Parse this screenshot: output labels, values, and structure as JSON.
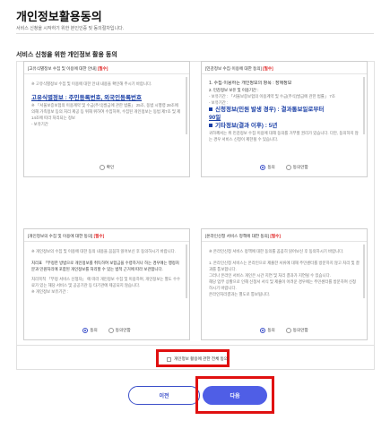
{
  "header": {
    "title": "개인정보활용동의",
    "subtitle": "서비스 신청을 시작하기 위한 본인인증 및 동의절차입니다."
  },
  "section_title": "서비스 신청을 위한 개인정보 활용 동의",
  "required_mark": "[필수]",
  "cards": [
    {
      "title": "[고유식별정보 수집 및 이용에 대한 안내]",
      "lines": [
        "※ 고유식별정보 수집 및 이용에 대한 안내 내용을 확인해 주시기 바랍니다.",
        "고유식별정보 : 주민등록번호, 외국인등록번호",
        "※ 「서울보증보험의 이용계약 및 수급(주식)발급에 관한 법률」 25조, 동법 시행령 28조에 의해 가족정보 등의 처리 제공 등 위해 위하여 수집하며, 수집된 개인정보는 동법 제7조 및 제14조에 따라 처리되는 정보",
        "- 보유기간"
      ],
      "options": [
        "확인"
      ],
      "selected": 0
    },
    {
      "title": "[민감정보 수집·이용에 대한 동의]",
      "lines": [
        "1. 수집·이용하는 개인정보의 항목 : 장애정보",
        "2. 민감정보 보유 및 이용기간 :",
        "- 보유기간 : 「서울보증보험의 이용계약 및 수급(주식)발급에 관한 법률」 7조",
        "- 보유기간 :",
        "신청정보(민원 발생 경우) : 결과통보일로부터",
        "90일",
        "기타정보(결과 이후) : 5년",
        "귀하께서는 위 민감정보 수집·이용에 대해 동의를 거부할 권리가 있습니다. 다만, 동의하지 않는 경우 서비스 신청이 제한될 수 있습니다."
      ],
      "options": [
        "동의",
        "동의안함"
      ],
      "selected": 0
    },
    {
      "title": "[개인정보의 수집 및 이용에 대한 동의]",
      "lines": [
        "※ 개인정보의 수집 및 이용에 대한 동의 내용을 꼼꼼히 읽어보신 후 동의하시기 바랍니다.",
        "처리표 「부정한 방법으로 개인정보를 취득하여 보험금을 수령하거나 하는 경우에는 행정처분과 민원처리에 포함된 개인정보를 처리할 수 있는 법적 근거에 따라 보관합니다.",
        "처리목적 「부정 서비스 신청자」 에 따라 개인정보 수집 및 이용하며, 개인정보는 별도 수수료가 있는 해당 서비스 및 공공기관 등 타기관에 제공되지 않습니다.",
        "※ 개인정보 보유기간 :"
      ],
      "options": [
        "동의",
        "동의안함"
      ],
      "selected": 0
    },
    {
      "title": "[온라인신청 서비스 정책에 대한 동의]",
      "lines": [
        "※ 온라인신청 서비스 정책에 대한 동의를 꼼꼼히 읽어보신 후 동의하시기 바랍니다.",
        "1. 온라인신청 서비스는 온라인으로 제출한 서류에 대해 주민센터를 방문하지 않고 처리 및 결과를 통보합니다.",
        "그러나 온라인 서비스 개인은 시간 지연 및 처리 결과가 지연될 수 있습니다.",
        "해당 업무 상황으로 인해 신청서 서식 및 제출이 어려운 경우에는 주민센터를 방문하여 신청하시기 바랍니다.",
        "온라인처리결과는 별도로 통보됩니다."
      ],
      "options": [
        "동의",
        "동의안함"
      ],
      "selected": 0
    }
  ],
  "agree_all_label": "개인정보 활용에 관한 전체 동의",
  "buttons": {
    "prev": "이전",
    "next": "다음"
  },
  "colors": {
    "accent": "#4f5ee6",
    "required": "#e02020",
    "highlight_box": "#e01010",
    "link": "#1a3fa6"
  }
}
